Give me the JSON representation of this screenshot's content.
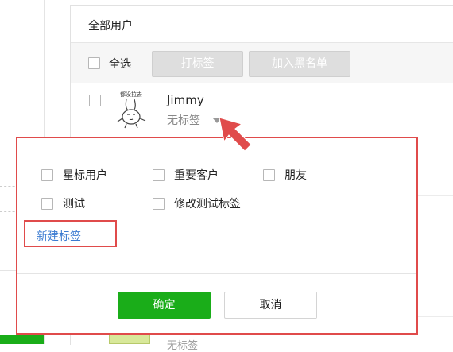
{
  "panel": {
    "title": "全部用户"
  },
  "toolbar": {
    "select_all_label": "全选",
    "tag_button": "打标签",
    "blacklist_button": "加入黑名单"
  },
  "user": {
    "name": "Jimmy",
    "tag_status": "无标签",
    "avatar_text": "都没拉去",
    "avatar_icon": "rabbit-cartoon-avatar"
  },
  "popup": {
    "options": [
      "星标用户",
      "重要客户",
      "朋友",
      "测试",
      "修改测试标签"
    ],
    "new_tag_link": "新建标签",
    "confirm_button": "确定",
    "cancel_button": "取消"
  },
  "background": {
    "next_user_tag": "无标签"
  },
  "colors": {
    "accent": "#1aad19",
    "highlight": "#e04b4b",
    "link": "#3b7bd1"
  },
  "icons": {
    "pointer": "red-arrow-icon",
    "dropdown": "caret-down-icon"
  }
}
